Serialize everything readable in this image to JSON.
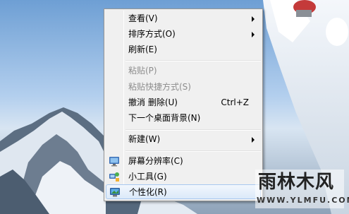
{
  "menu": {
    "items": [
      {
        "label": "查看(V)",
        "submenu": true
      },
      {
        "label": "排序方式(O)",
        "submenu": true
      },
      {
        "label": "刷新(E)"
      },
      {
        "label": "粘贴(P)",
        "disabled": true
      },
      {
        "label": "粘贴快捷方式(S)",
        "disabled": true
      },
      {
        "label": "撤消 删除(U)",
        "shortcut": "Ctrl+Z"
      },
      {
        "label": "下一个桌面背景(N)"
      },
      {
        "label": "新建(W)",
        "submenu": true
      },
      {
        "label": "屏幕分辨率(C)",
        "icon": "monitor-icon"
      },
      {
        "label": "小工具(G)",
        "icon": "gadgets-icon"
      },
      {
        "label": "个性化(R)",
        "icon": "personalize-icon",
        "highlighted": true
      }
    ]
  },
  "watermark": {
    "title": "雨林木风",
    "url": "WWW.YLMFU.COM"
  },
  "colors": {
    "menu_bg": "#f0f0f0",
    "menu_border": "#979797",
    "highlight": "#dbe9f9",
    "disabled_text": "#8d8d8d"
  }
}
